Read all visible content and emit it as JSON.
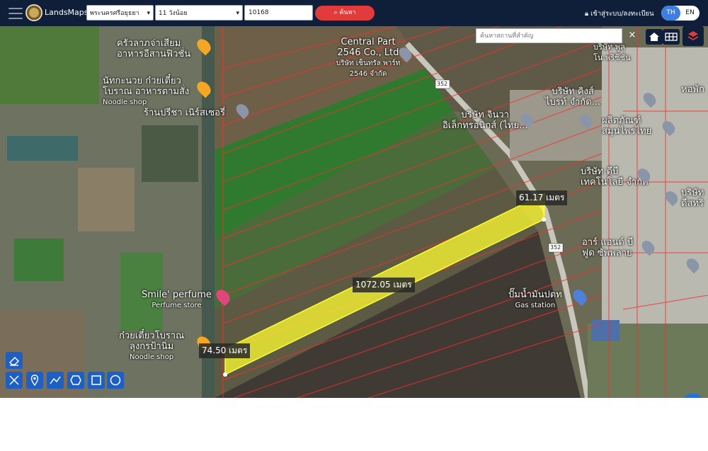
{
  "header": {
    "brand": "LandsMaps",
    "province": "พระนครศรีอยุธยา",
    "district": "11 วังน้อย",
    "parcel_no": "10168",
    "search_label": "ค้นหา",
    "login_label": "เข้าสู่ระบบ/ลงทะเบียน",
    "lang_th": "TH",
    "lang_en": "EN"
  },
  "map": {
    "place_search_placeholder": "ค้นหาสถานที่สำคัญ",
    "clear_label": "×",
    "road_number": "352",
    "measurements": {
      "right_edge": "61.17 เมตร",
      "long_edge": "1072.05 เมตร",
      "left_edge": "74.50 เมตร"
    },
    "pois": [
      {
        "line1": "ครัวลาภจ่าเสียม",
        "line2": "อาหารอีสานฟิวชั่น",
        "sub": ""
      },
      {
        "line1": "นัทกะนวย ก๋วยเตี๋ยว",
        "line2": "โบราณ อาหารตามสั่ง",
        "sub": "Noodle shop"
      },
      {
        "line1": "ร้านปรีชา เนิร์สเซอรี่",
        "line2": "",
        "sub": ""
      },
      {
        "line1": "Central Part",
        "line2": "2546 Co., Ltd",
        "sub": "บริษัท เซ็นทรัล พาร์ท 2546 จำกัด"
      },
      {
        "line1": "บริษัท จินวา",
        "line2": "อิเล็กทรอนิกส์ (ไทย...",
        "sub": ""
      },
      {
        "line1": "บริษัท คิงส์",
        "line2": "ไบรท์ จำกัด...",
        "sub": ""
      },
      {
        "line1": "ผลิตภัณฑ์",
        "line2": "สมุนไพรไทย",
        "sub": ""
      },
      {
        "line1": "บริษัท ดีบี",
        "line2": "เทคโนโลยี จำกัด",
        "sub": ""
      },
      {
        "line1": "บริษัท",
        "line2": "ดีสทริ",
        "sub": ""
      },
      {
        "line1": "อาร์ แอนด์ บี",
        "line2": "ฟูด ซัพพลาย",
        "sub": ""
      },
      {
        "line1": "Smile' perfume",
        "line2": "",
        "sub": "Perfume store"
      },
      {
        "line1": "ปั๊มน้ำมันปตท",
        "line2": "",
        "sub": "Gas station"
      },
      {
        "line1": "ก๋วยเตี๋ยวโบราณ",
        "line2": "ลุงกรป้านิ่ม",
        "sub": "Noodle shop"
      },
      {
        "line1": "หอพัก",
        "line2": "",
        "sub": ""
      },
      {
        "line1": "บริษัท พูล",
        "line2": "โน พริซิชั่น",
        "sub": ""
      }
    ]
  },
  "icons": {
    "menu": "menu-icon",
    "home": "home-icon",
    "grid": "grid-icon",
    "layers": "layers-icon",
    "eraser": "eraser-icon",
    "measure": "ruler-icon",
    "pin": "pin-icon",
    "polyline": "polyline-icon",
    "polygon": "polygon-icon",
    "rectangle": "rectangle-icon",
    "circle": "circle-icon",
    "more": "more-icon"
  },
  "colors": {
    "header_bg": "#0f1f3a",
    "accent_red": "#e23b3b",
    "accent_blue": "#3d7fe0",
    "parcel_outline": "#ff2a2a",
    "selected_parcel": "#ffff30"
  }
}
